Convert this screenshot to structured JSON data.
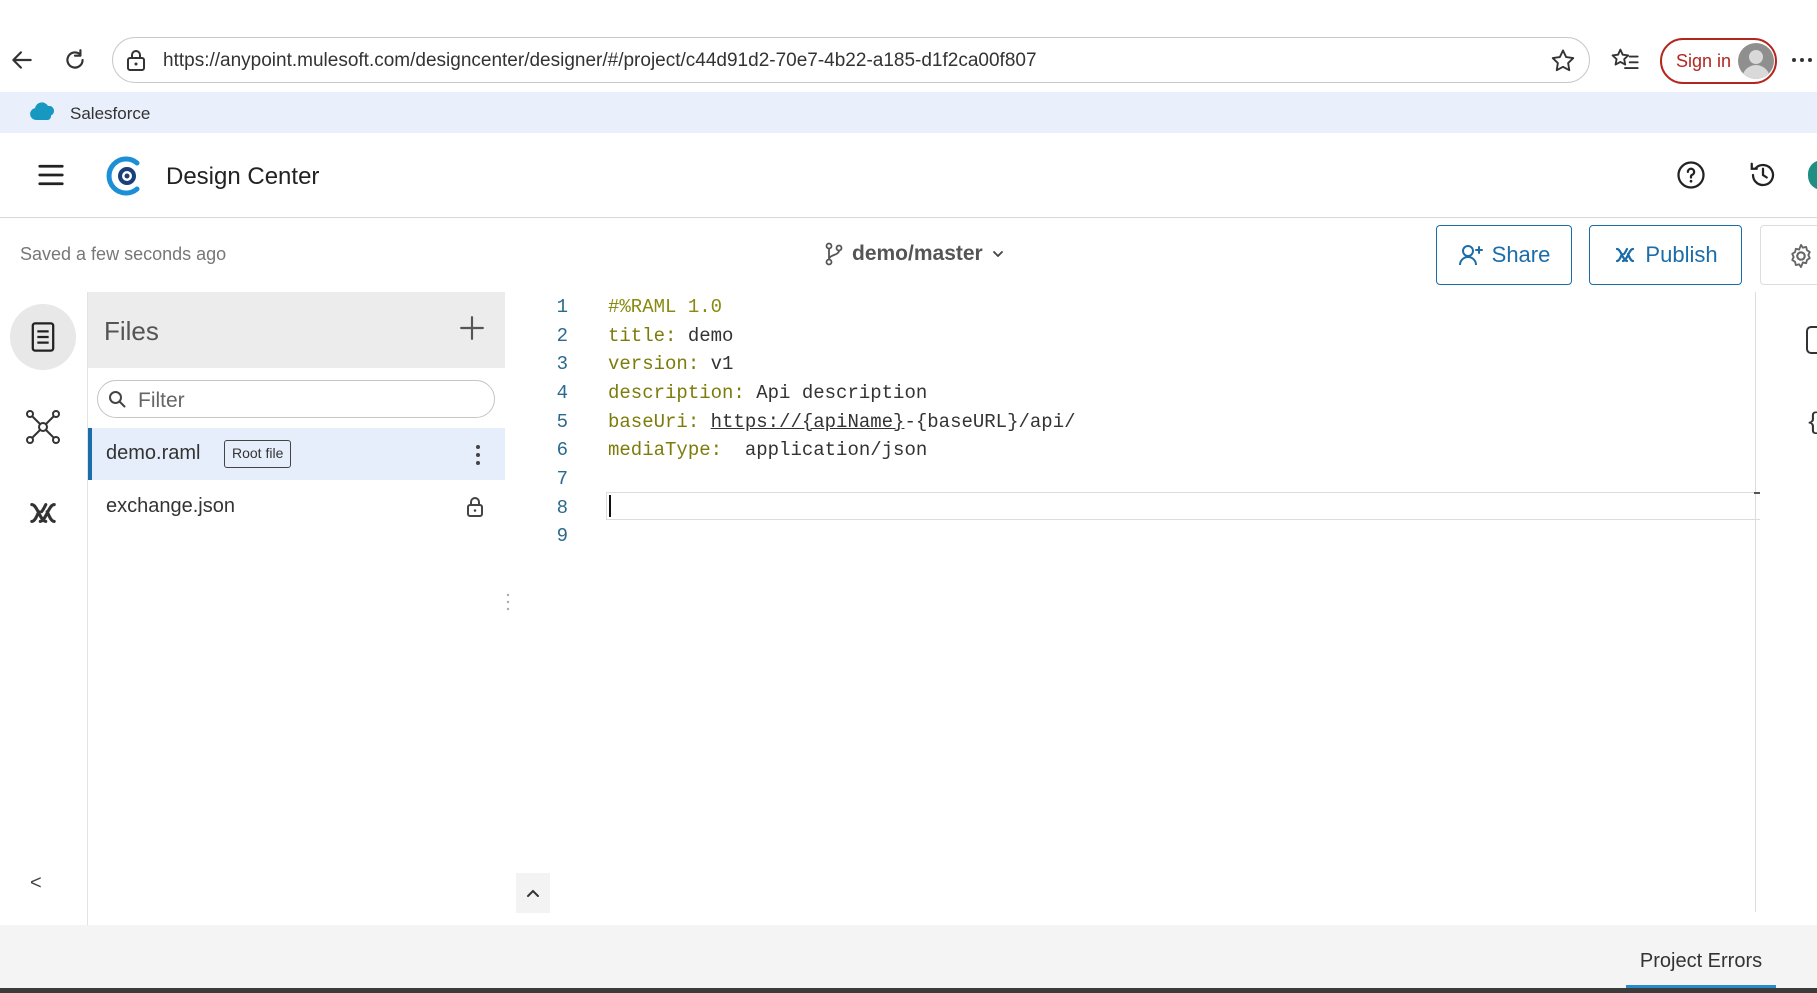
{
  "browser": {
    "url": "https://anypoint.mulesoft.com/designcenter/designer/#/project/c44d91d2-70e7-4b22-a185-d1f2ca00f807",
    "sign_in_label": "Sign in",
    "favorites": [
      {
        "label": "Salesforce",
        "icon": "salesforce-cloud-icon"
      }
    ]
  },
  "app": {
    "title": "Design Center"
  },
  "toolbar": {
    "saved_status": "Saved a few seconds ago",
    "branch": "demo/master",
    "share_label": "Share",
    "publish_label": "Publish"
  },
  "files_panel": {
    "title": "Files",
    "filter_placeholder": "Filter",
    "files": [
      {
        "name": "demo.raml",
        "badge": "Root file",
        "selected": true
      },
      {
        "name": "exchange.json",
        "locked": true
      }
    ]
  },
  "editor": {
    "lines": [
      {
        "n": "1",
        "text": "#%RAML 1.0"
      },
      {
        "n": "2",
        "key": "title:",
        "value": " demo"
      },
      {
        "n": "3",
        "key": "version:",
        "value": " v1"
      },
      {
        "n": "4",
        "key": "description:",
        "value": " Api description"
      },
      {
        "n": "5",
        "key": "baseUri:",
        "value_underlined": "https://{apiName}",
        "value": "-{baseURL}/api/"
      },
      {
        "n": "6",
        "key": "mediaType:",
        "value": "  application/json"
      },
      {
        "n": "7"
      },
      {
        "n": "8"
      },
      {
        "n": "9"
      }
    ],
    "cursor_line": 8
  },
  "bottom": {
    "project_errors_label": "Project Errors"
  },
  "colors": {
    "accent": "#1b6ca8",
    "signin": "#b3261e",
    "favbar": "#e9f0fb",
    "raml_key": "#7d7b0a"
  }
}
